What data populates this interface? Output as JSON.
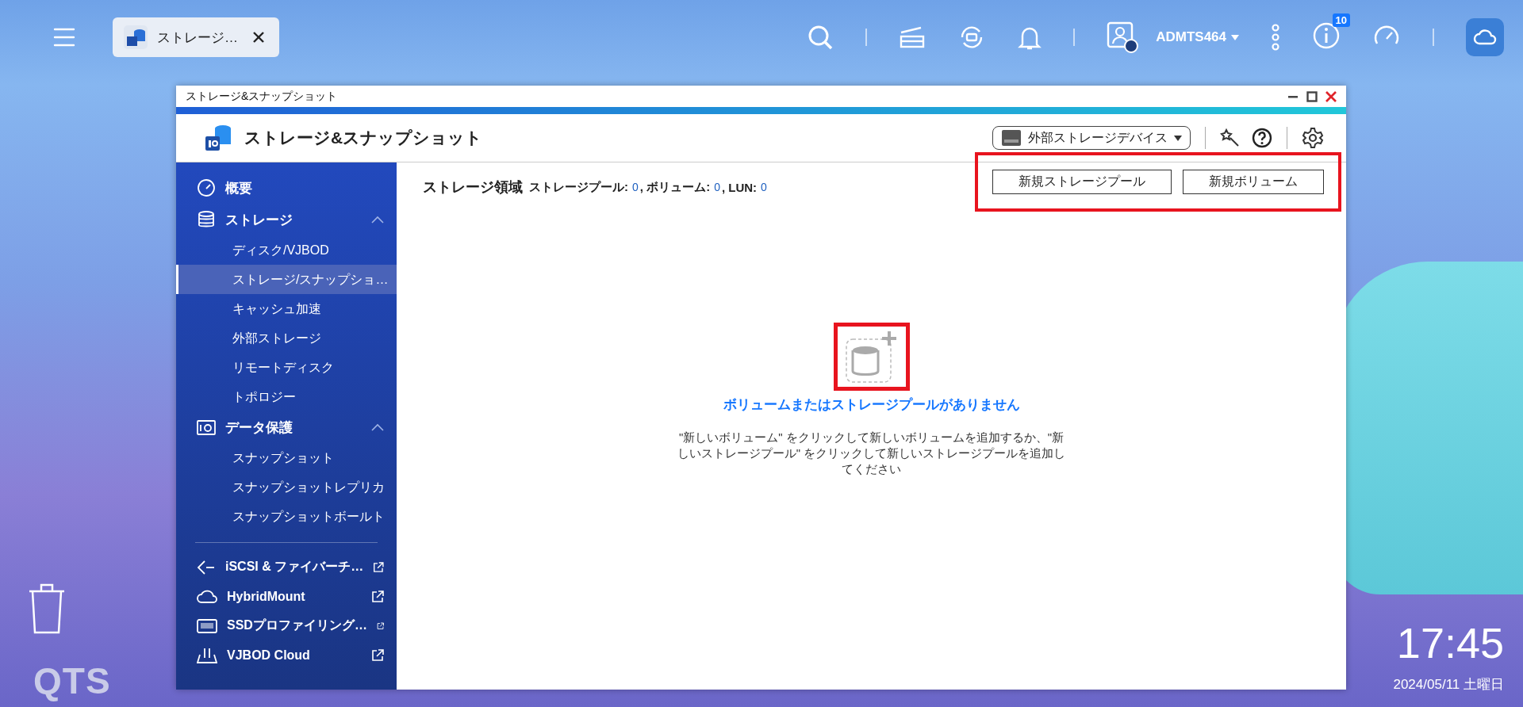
{
  "taskbar": {
    "tab": {
      "label": "ストレージ…"
    },
    "user": "ADMTS464",
    "notification_count": "10"
  },
  "window": {
    "title": "ストレージ&スナップショット",
    "app_title": "ストレージ&スナップショット",
    "device_dropdown": "外部ストレージデバイス"
  },
  "sidebar": {
    "items": [
      {
        "label": "概要",
        "kind": "section"
      },
      {
        "label": "ストレージ",
        "kind": "section",
        "expanded": true,
        "children": [
          {
            "label": "ディスク/VJBOD",
            "selected": false
          },
          {
            "label": "ストレージ/スナップショ…",
            "selected": true
          },
          {
            "label": "キャッシュ加速",
            "selected": false
          },
          {
            "label": "外部ストレージ",
            "selected": false
          },
          {
            "label": "リモートディスク",
            "selected": false
          },
          {
            "label": "トポロジー",
            "selected": false
          }
        ]
      },
      {
        "label": "データ保護",
        "kind": "section",
        "expanded": true,
        "children": [
          {
            "label": "スナップショット",
            "selected": false
          },
          {
            "label": "スナップショットレプリカ",
            "selected": false
          },
          {
            "label": "スナップショットボールト",
            "selected": false
          }
        ]
      },
      {
        "label": "iSCSI & ファイバーチ…",
        "kind": "external"
      },
      {
        "label": "HybridMount",
        "kind": "external"
      },
      {
        "label": "SSDプロファイリング…",
        "kind": "external"
      },
      {
        "label": "VJBOD Cloud",
        "kind": "external"
      }
    ]
  },
  "main": {
    "heading": "ストレージ領域",
    "stats": [
      {
        "label": "ストレージプール:",
        "value": "0"
      },
      {
        "label": ", ボリューム:",
        "value": "0"
      },
      {
        "label": ", LUN:",
        "value": "0"
      }
    ],
    "buttons": [
      "新規ストレージプール",
      "新規ボリューム"
    ],
    "empty_title": "ボリュームまたはストレージプールがありません",
    "empty_text": "\"新しいボリューム\" をクリックして新しいボリュームを追加するか、\"新しいストレージプール\" をクリックして新しいストレージプールを追加してください"
  },
  "desktop": {
    "logo": "QTS",
    "time": "17:45",
    "date": "2024/05/11 土曜日"
  }
}
